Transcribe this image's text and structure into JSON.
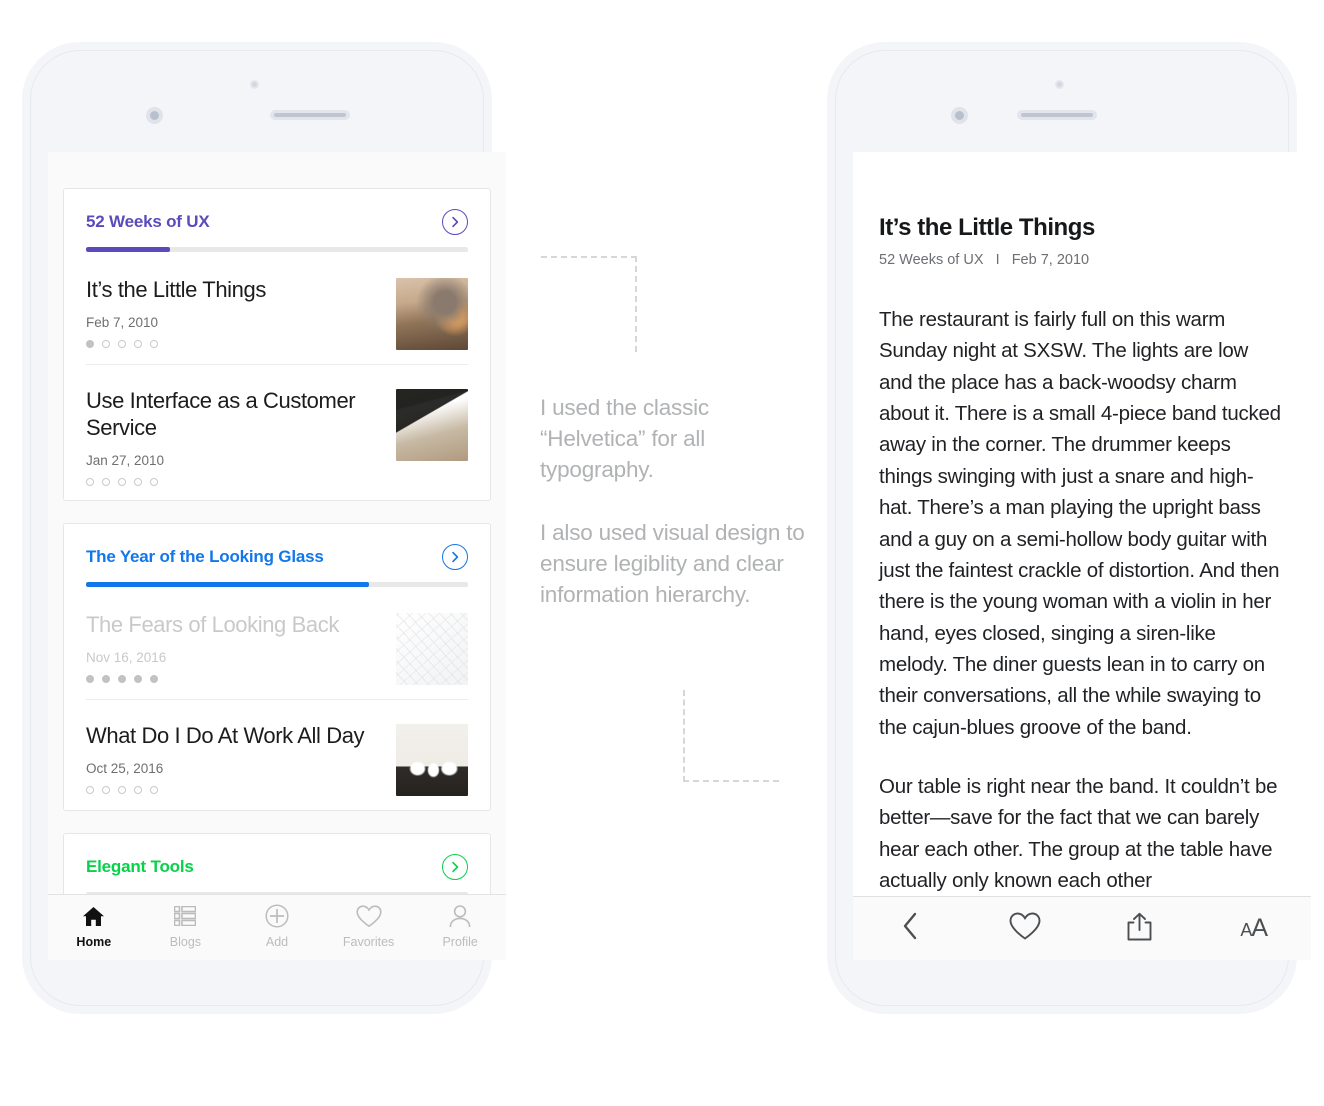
{
  "left_phone": {
    "cards": [
      {
        "title": "52 Weeks of UX",
        "accent": "#5a4bbd",
        "progress_percent": 22,
        "chevron_icon": "chevron-right-circle-icon",
        "posts": [
          {
            "title": "It’s the Little Things",
            "date": "Feb 7, 2010",
            "dots_total": 5,
            "dots_filled": 1,
            "read": false,
            "thumb_icon": "workshop-photo"
          },
          {
            "title": "Use Interface as a Customer Service",
            "date": "Jan 27, 2010",
            "dots_total": 5,
            "dots_filled": 0,
            "read": false,
            "thumb_icon": "desk-photo"
          }
        ]
      },
      {
        "title": "The Year of the Looking Glass",
        "accent": "#1277ea",
        "progress_percent": 74,
        "chevron_icon": "chevron-right-circle-icon",
        "posts": [
          {
            "title": "The Fears of Looking Back",
            "date": "Nov 16, 2016",
            "dots_total": 5,
            "dots_filled": 5,
            "read": true,
            "thumb_icon": "glass-architecture-photo"
          },
          {
            "title": "What Do I Do At Work All Day",
            "date": "Oct 25, 2016",
            "dots_total": 5,
            "dots_filled": 0,
            "read": false,
            "thumb_icon": "meeting-room-photo"
          }
        ]
      },
      {
        "title": "Elegant Tools",
        "accent": "#06d24a",
        "progress_percent": 0,
        "chevron_icon": "chevron-right-circle-icon",
        "posts": []
      }
    ],
    "tabbar": [
      {
        "label": "Home",
        "icon": "home-icon",
        "active": true
      },
      {
        "label": "Blogs",
        "icon": "list-icon",
        "active": false
      },
      {
        "label": "Add",
        "icon": "plus-circle-icon",
        "active": false
      },
      {
        "label": "Favorites",
        "icon": "heart-icon",
        "active": false
      },
      {
        "label": "Profile",
        "icon": "person-icon",
        "active": false
      }
    ]
  },
  "annotation": {
    "paragraph_1": "I used the classic “Helvetica” for all typography.",
    "paragraph_2": "I also used visual design to ensure legiblity and clear information hierarchy."
  },
  "right_phone": {
    "article": {
      "title": "It’s the Little Things",
      "meta": "52 Weeks of UX   I   Feb 7, 2010",
      "source": "52 Weeks of UX",
      "date": "Feb 7, 2010",
      "paragraph_1": "The restaurant is fairly full on this warm Sunday night at SXSW. The lights are low and the place has a back-woodsy charm about it. There is a small 4-piece band tucked away in the corner. The drummer keeps things swinging with just a snare and high-hat. There’s a man playing the upright bass and a guy on a semi-hollow body guitar with just the faintest crackle of distortion. And then there is the young woman with a violin in her hand, eyes closed, singing a siren-like melody. The diner guests lean in to carry on their conversations, all the while swaying to the cajun-blues groove of the band.",
      "paragraph_2": "Our table is right near the band. It couldn’t be better—save for the fact that we can barely hear each other. The group at the table have actually only known each other"
    },
    "toolbar": [
      {
        "icon": "back-chevron-icon",
        "label": "Back"
      },
      {
        "icon": "heart-icon",
        "label": "Favorite"
      },
      {
        "icon": "share-icon",
        "label": "Share"
      },
      {
        "icon": "text-size-icon",
        "label": "AA"
      }
    ]
  }
}
